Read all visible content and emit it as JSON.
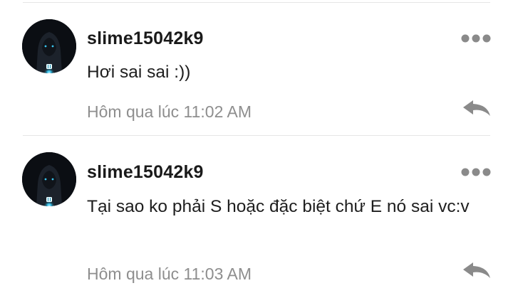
{
  "comments": [
    {
      "username": "slime15042k9",
      "message": "Hơi sai sai :))",
      "timestamp": "Hôm qua lúc 11:02 AM",
      "avatar_icon": "dark-hooded-figure-avatar",
      "more_icon": "more-horizontal-icon",
      "reply_icon": "reply-arrow-icon"
    },
    {
      "username": "slime15042k9",
      "message": "Tại sao ko phải S hoặc đặc biệt chứ E nó sai vc:v",
      "timestamp": "Hôm qua lúc 11:03 AM",
      "avatar_icon": "dark-hooded-figure-avatar",
      "more_icon": "more-horizontal-icon",
      "reply_icon": "reply-arrow-icon"
    }
  ],
  "colors": {
    "username": "#1a1a1a",
    "message": "#1e1e1e",
    "timestamp": "#8e8e8e",
    "icon": "#8a8a8a",
    "divider": "#e6e6e6",
    "avatar_background": "#0b0e13",
    "avatar_glow": "#39c6f0"
  }
}
